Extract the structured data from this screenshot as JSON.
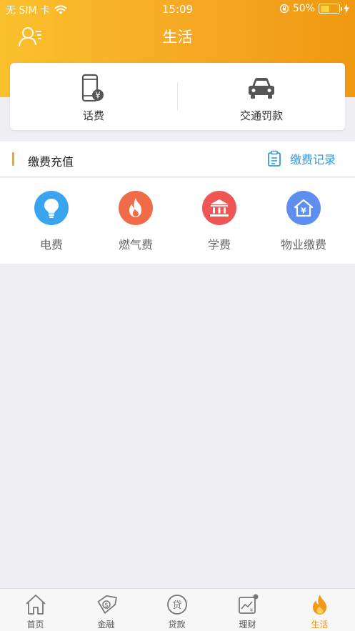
{
  "status_bar": {
    "carrier": "无 SIM 卡",
    "time": "15:09",
    "battery_percent": "50%",
    "battery_level": 0.5
  },
  "header": {
    "title": "生活"
  },
  "top_services": [
    {
      "label": "话费",
      "icon": "phone-yuan-icon"
    },
    {
      "label": "交通罚款",
      "icon": "car-icon"
    }
  ],
  "section": {
    "title": "缴费充值",
    "record_label": "缴费记录"
  },
  "payment_items": [
    {
      "label": "电费",
      "icon": "lightbulb-icon",
      "color": "#3aa5ee"
    },
    {
      "label": "燃气费",
      "icon": "flame-icon",
      "color": "#f06b48"
    },
    {
      "label": "学费",
      "icon": "bank-icon",
      "color": "#f05656"
    },
    {
      "label": "物业缴费",
      "icon": "house-yuan-icon",
      "color": "#5d8ef0"
    }
  ],
  "tabbar": {
    "items": [
      {
        "label": "首页",
        "icon": "home-icon",
        "active": false
      },
      {
        "label": "金融",
        "icon": "finance-icon",
        "active": false
      },
      {
        "label": "贷款",
        "icon": "loan-icon",
        "active": false
      },
      {
        "label": "理财",
        "icon": "wealth-icon",
        "active": false
      },
      {
        "label": "生活",
        "icon": "flame-icon",
        "active": true
      }
    ],
    "active_color": "#f19a1a"
  },
  "colors": {
    "header_start": "#fbc02d",
    "header_end": "#ef9a10",
    "accent_bar": "#f5a623",
    "link_blue": "#2b9be4"
  }
}
